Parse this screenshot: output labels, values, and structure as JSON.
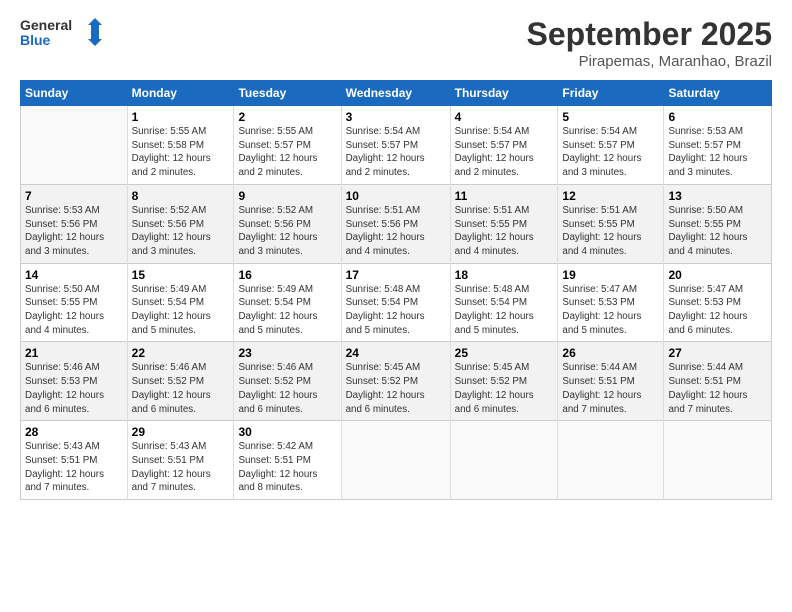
{
  "header": {
    "logo_line1": "General",
    "logo_line2": "Blue",
    "month": "September 2025",
    "location": "Pirapemas, Maranhao, Brazil"
  },
  "weekdays": [
    "Sunday",
    "Monday",
    "Tuesday",
    "Wednesday",
    "Thursday",
    "Friday",
    "Saturday"
  ],
  "weeks": [
    [
      {
        "day": "",
        "info": ""
      },
      {
        "day": "1",
        "info": "Sunrise: 5:55 AM\nSunset: 5:58 PM\nDaylight: 12 hours\nand 2 minutes."
      },
      {
        "day": "2",
        "info": "Sunrise: 5:55 AM\nSunset: 5:57 PM\nDaylight: 12 hours\nand 2 minutes."
      },
      {
        "day": "3",
        "info": "Sunrise: 5:54 AM\nSunset: 5:57 PM\nDaylight: 12 hours\nand 2 minutes."
      },
      {
        "day": "4",
        "info": "Sunrise: 5:54 AM\nSunset: 5:57 PM\nDaylight: 12 hours\nand 2 minutes."
      },
      {
        "day": "5",
        "info": "Sunrise: 5:54 AM\nSunset: 5:57 PM\nDaylight: 12 hours\nand 3 minutes."
      },
      {
        "day": "6",
        "info": "Sunrise: 5:53 AM\nSunset: 5:57 PM\nDaylight: 12 hours\nand 3 minutes."
      }
    ],
    [
      {
        "day": "7",
        "info": "Sunrise: 5:53 AM\nSunset: 5:56 PM\nDaylight: 12 hours\nand 3 minutes."
      },
      {
        "day": "8",
        "info": "Sunrise: 5:52 AM\nSunset: 5:56 PM\nDaylight: 12 hours\nand 3 minutes."
      },
      {
        "day": "9",
        "info": "Sunrise: 5:52 AM\nSunset: 5:56 PM\nDaylight: 12 hours\nand 3 minutes."
      },
      {
        "day": "10",
        "info": "Sunrise: 5:51 AM\nSunset: 5:56 PM\nDaylight: 12 hours\nand 4 minutes."
      },
      {
        "day": "11",
        "info": "Sunrise: 5:51 AM\nSunset: 5:55 PM\nDaylight: 12 hours\nand 4 minutes."
      },
      {
        "day": "12",
        "info": "Sunrise: 5:51 AM\nSunset: 5:55 PM\nDaylight: 12 hours\nand 4 minutes."
      },
      {
        "day": "13",
        "info": "Sunrise: 5:50 AM\nSunset: 5:55 PM\nDaylight: 12 hours\nand 4 minutes."
      }
    ],
    [
      {
        "day": "14",
        "info": "Sunrise: 5:50 AM\nSunset: 5:55 PM\nDaylight: 12 hours\nand 4 minutes."
      },
      {
        "day": "15",
        "info": "Sunrise: 5:49 AM\nSunset: 5:54 PM\nDaylight: 12 hours\nand 5 minutes."
      },
      {
        "day": "16",
        "info": "Sunrise: 5:49 AM\nSunset: 5:54 PM\nDaylight: 12 hours\nand 5 minutes."
      },
      {
        "day": "17",
        "info": "Sunrise: 5:48 AM\nSunset: 5:54 PM\nDaylight: 12 hours\nand 5 minutes."
      },
      {
        "day": "18",
        "info": "Sunrise: 5:48 AM\nSunset: 5:54 PM\nDaylight: 12 hours\nand 5 minutes."
      },
      {
        "day": "19",
        "info": "Sunrise: 5:47 AM\nSunset: 5:53 PM\nDaylight: 12 hours\nand 5 minutes."
      },
      {
        "day": "20",
        "info": "Sunrise: 5:47 AM\nSunset: 5:53 PM\nDaylight: 12 hours\nand 6 minutes."
      }
    ],
    [
      {
        "day": "21",
        "info": "Sunrise: 5:46 AM\nSunset: 5:53 PM\nDaylight: 12 hours\nand 6 minutes."
      },
      {
        "day": "22",
        "info": "Sunrise: 5:46 AM\nSunset: 5:52 PM\nDaylight: 12 hours\nand 6 minutes."
      },
      {
        "day": "23",
        "info": "Sunrise: 5:46 AM\nSunset: 5:52 PM\nDaylight: 12 hours\nand 6 minutes."
      },
      {
        "day": "24",
        "info": "Sunrise: 5:45 AM\nSunset: 5:52 PM\nDaylight: 12 hours\nand 6 minutes."
      },
      {
        "day": "25",
        "info": "Sunrise: 5:45 AM\nSunset: 5:52 PM\nDaylight: 12 hours\nand 6 minutes."
      },
      {
        "day": "26",
        "info": "Sunrise: 5:44 AM\nSunset: 5:51 PM\nDaylight: 12 hours\nand 7 minutes."
      },
      {
        "day": "27",
        "info": "Sunrise: 5:44 AM\nSunset: 5:51 PM\nDaylight: 12 hours\nand 7 minutes."
      }
    ],
    [
      {
        "day": "28",
        "info": "Sunrise: 5:43 AM\nSunset: 5:51 PM\nDaylight: 12 hours\nand 7 minutes."
      },
      {
        "day": "29",
        "info": "Sunrise: 5:43 AM\nSunset: 5:51 PM\nDaylight: 12 hours\nand 7 minutes."
      },
      {
        "day": "30",
        "info": "Sunrise: 5:42 AM\nSunset: 5:51 PM\nDaylight: 12 hours\nand 8 minutes."
      },
      {
        "day": "",
        "info": ""
      },
      {
        "day": "",
        "info": ""
      },
      {
        "day": "",
        "info": ""
      },
      {
        "day": "",
        "info": ""
      }
    ]
  ]
}
